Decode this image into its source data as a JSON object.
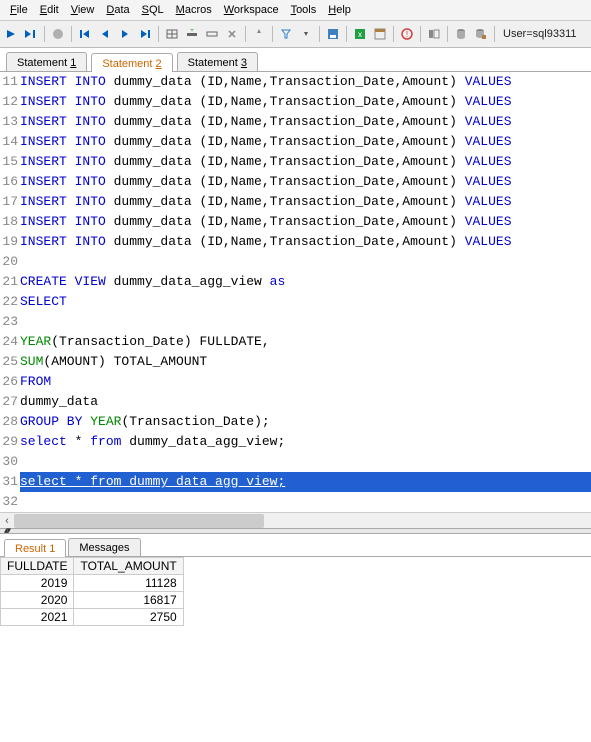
{
  "menubar": {
    "items": [
      {
        "label": "File",
        "ul": "F"
      },
      {
        "label": "Edit",
        "ul": "E"
      },
      {
        "label": "View",
        "ul": "V"
      },
      {
        "label": "Data",
        "ul": "D"
      },
      {
        "label": "SQL",
        "ul": "S"
      },
      {
        "label": "Macros",
        "ul": "M"
      },
      {
        "label": "Workspace",
        "ul": "W"
      },
      {
        "label": "Tools",
        "ul": "T"
      },
      {
        "label": "Help",
        "ul": "H"
      }
    ]
  },
  "toolbar": {
    "user_label": "User=sql93311"
  },
  "tabs": {
    "items": [
      {
        "label": "Statement 1",
        "ul": "1",
        "active": false
      },
      {
        "label": "Statement 2",
        "ul": "2",
        "active": true
      },
      {
        "label": "Statement 3",
        "ul": "3",
        "active": false
      }
    ]
  },
  "editor": {
    "lines": [
      {
        "n": 11,
        "tokens": [
          {
            "t": "INSERT INTO",
            "c": "kw-blue"
          },
          {
            "t": " dummy_data (ID,Name,Transaction_Date,Amount) ",
            "c": "plain"
          },
          {
            "t": "VALUES",
            "c": "kw-blue"
          }
        ]
      },
      {
        "n": 12,
        "tokens": [
          {
            "t": "INSERT INTO",
            "c": "kw-blue"
          },
          {
            "t": " dummy_data (ID,Name,Transaction_Date,Amount) ",
            "c": "plain"
          },
          {
            "t": "VALUES",
            "c": "kw-blue"
          }
        ]
      },
      {
        "n": 13,
        "tokens": [
          {
            "t": "INSERT INTO",
            "c": "kw-blue"
          },
          {
            "t": " dummy_data (ID,Name,Transaction_Date,Amount) ",
            "c": "plain"
          },
          {
            "t": "VALUES",
            "c": "kw-blue"
          }
        ]
      },
      {
        "n": 14,
        "tokens": [
          {
            "t": "INSERT INTO",
            "c": "kw-blue"
          },
          {
            "t": " dummy_data (ID,Name,Transaction_Date,Amount) ",
            "c": "plain"
          },
          {
            "t": "VALUES",
            "c": "kw-blue"
          }
        ]
      },
      {
        "n": 15,
        "tokens": [
          {
            "t": "INSERT INTO",
            "c": "kw-blue"
          },
          {
            "t": " dummy_data (ID,Name,Transaction_Date,Amount) ",
            "c": "plain"
          },
          {
            "t": "VALUES",
            "c": "kw-blue"
          }
        ]
      },
      {
        "n": 16,
        "tokens": [
          {
            "t": "INSERT INTO",
            "c": "kw-blue"
          },
          {
            "t": " dummy_data (ID,Name,Transaction_Date,Amount) ",
            "c": "plain"
          },
          {
            "t": "VALUES",
            "c": "kw-blue"
          }
        ]
      },
      {
        "n": 17,
        "tokens": [
          {
            "t": "INSERT INTO",
            "c": "kw-blue"
          },
          {
            "t": " dummy_data (ID,Name,Transaction_Date,Amount) ",
            "c": "plain"
          },
          {
            "t": "VALUES",
            "c": "kw-blue"
          }
        ]
      },
      {
        "n": 18,
        "tokens": [
          {
            "t": "INSERT INTO",
            "c": "kw-blue"
          },
          {
            "t": " dummy_data (ID,Name,Transaction_Date,Amount) ",
            "c": "plain"
          },
          {
            "t": "VALUES",
            "c": "kw-blue"
          }
        ]
      },
      {
        "n": 19,
        "tokens": [
          {
            "t": "INSERT INTO",
            "c": "kw-blue"
          },
          {
            "t": " dummy_data (ID,Name,Transaction_Date,Amount) ",
            "c": "plain"
          },
          {
            "t": "VALUES",
            "c": "kw-blue"
          }
        ]
      },
      {
        "n": 20,
        "tokens": [
          {
            "t": " ",
            "c": "plain"
          }
        ]
      },
      {
        "n": 21,
        "tokens": [
          {
            "t": "CREATE VIEW",
            "c": "kw-blue"
          },
          {
            "t": " dummy_data_agg_view ",
            "c": "plain"
          },
          {
            "t": "as",
            "c": "kw-blue"
          }
        ]
      },
      {
        "n": 22,
        "tokens": [
          {
            "t": "SELECT",
            "c": "kw-blue"
          }
        ]
      },
      {
        "n": 23,
        "tokens": [
          {
            "t": " ",
            "c": "plain"
          }
        ]
      },
      {
        "n": 24,
        "tokens": [
          {
            "t": "YEAR",
            "c": "kw-green"
          },
          {
            "t": "(Transaction_Date) FULLDATE,",
            "c": "plain"
          }
        ]
      },
      {
        "n": 25,
        "tokens": [
          {
            "t": "SUM",
            "c": "kw-green"
          },
          {
            "t": "(AMOUNT) TOTAL_AMOUNT",
            "c": "plain"
          }
        ]
      },
      {
        "n": 26,
        "tokens": [
          {
            "t": "FROM",
            "c": "kw-blue"
          }
        ]
      },
      {
        "n": 27,
        "tokens": [
          {
            "t": "dummy_data",
            "c": "plain"
          }
        ]
      },
      {
        "n": 28,
        "tokens": [
          {
            "t": "GROUP BY",
            "c": "kw-blue"
          },
          {
            "t": " ",
            "c": "plain"
          },
          {
            "t": "YEAR",
            "c": "kw-green"
          },
          {
            "t": "(Transaction_Date);",
            "c": "plain"
          }
        ]
      },
      {
        "n": 29,
        "tokens": [
          {
            "t": "select",
            "c": "kw-blue"
          },
          {
            "t": " * ",
            "c": "plain"
          },
          {
            "t": "from",
            "c": "kw-blue"
          },
          {
            "t": " dummy_data_agg_view;",
            "c": "plain"
          }
        ]
      },
      {
        "n": 30,
        "tokens": [
          {
            "t": " ",
            "c": "plain"
          }
        ]
      },
      {
        "n": 31,
        "selected": true,
        "tokens": [
          {
            "t": "select",
            "c": "kw-blue"
          },
          {
            "t": " * ",
            "c": "plain"
          },
          {
            "t": "from",
            "c": "kw-blue"
          },
          {
            "t": " dummy_data_agg_view;",
            "c": "plain"
          }
        ]
      },
      {
        "n": 32,
        "tokens": [
          {
            "t": " ",
            "c": "plain"
          }
        ]
      }
    ]
  },
  "result_tabs": {
    "items": [
      {
        "label": "Result 1",
        "active": true
      },
      {
        "label": "Messages",
        "active": false
      }
    ]
  },
  "result_grid": {
    "columns": [
      "FULLDATE",
      "TOTAL_AMOUNT"
    ],
    "rows": [
      [
        "2019",
        "11128"
      ],
      [
        "2020",
        "16817"
      ],
      [
        "2021",
        "2750"
      ]
    ]
  }
}
